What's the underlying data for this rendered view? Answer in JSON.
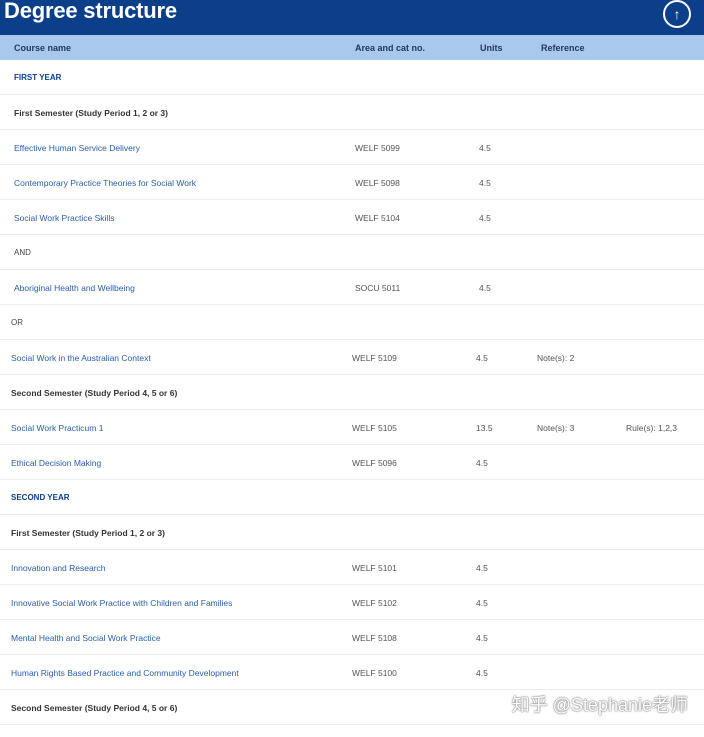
{
  "page": {
    "title": "Degree structure",
    "up_icon": "arrow-up-icon"
  },
  "table": {
    "headers": {
      "name": "Course name",
      "code": "Area and cat no.",
      "units": "Units",
      "ref": "Reference"
    },
    "rows": [
      {
        "kind": "sec",
        "name": "FIRST YEAR"
      },
      {
        "kind": "sem",
        "name": "First Semester (Study Period 1, 2 or 3)"
      },
      {
        "kind": "course",
        "name": "Effective Human Service Delivery",
        "code": "WELF 5099",
        "units": "4.5"
      },
      {
        "kind": "course",
        "name": "Contemporary Practice Theories for Social Work",
        "code": "WELF 5098",
        "units": "4.5"
      },
      {
        "kind": "course",
        "name": "Social Work Practice Skills",
        "code": "WELF 5104",
        "units": "4.5"
      },
      {
        "kind": "conn",
        "name": "AND"
      },
      {
        "kind": "course",
        "name": "Aboriginal Health and Wellbeing",
        "code": "SOCU 5011",
        "units": "4.5"
      },
      {
        "kind": "conn",
        "name": "OR"
      },
      {
        "kind": "course",
        "name": "Social Work in the Australian Context",
        "code": "WELF 5109",
        "units": "4.5",
        "ref": "Note(s): 2"
      },
      {
        "kind": "sem",
        "name": "Second Semester (Study Period 4, 5 or 6)"
      },
      {
        "kind": "course",
        "name": "Social Work Practicum 1",
        "code": "WELF 5105",
        "units": "13.5",
        "ref": "Note(s): 3",
        "rule": "Rule(s): 1,2,3"
      },
      {
        "kind": "course",
        "name": "Ethical Decision Making",
        "code": "WELF 5096",
        "units": "4.5"
      },
      {
        "kind": "sec",
        "name": "SECOND YEAR"
      },
      {
        "kind": "sem",
        "name": "First Semester (Study Period 1, 2 or 3)"
      },
      {
        "kind": "course",
        "name": "Innovation and Research",
        "code": "WELF 5101",
        "units": "4.5"
      },
      {
        "kind": "course",
        "name": "Innovative Social Work Practice with Children and Families",
        "code": "WELF 5102",
        "units": "4.5"
      },
      {
        "kind": "course",
        "name": "Mental Health and Social Work Practice",
        "code": "WELF 5108",
        "units": "4.5"
      },
      {
        "kind": "course",
        "name": "Human Rights Based Practice and Community Development",
        "code": "WELF 5100",
        "units": "4.5"
      },
      {
        "kind": "sem",
        "name": "Second Semester (Study Period 4, 5 or 6)"
      }
    ]
  },
  "watermark": "知乎 @Stephanie老师"
}
